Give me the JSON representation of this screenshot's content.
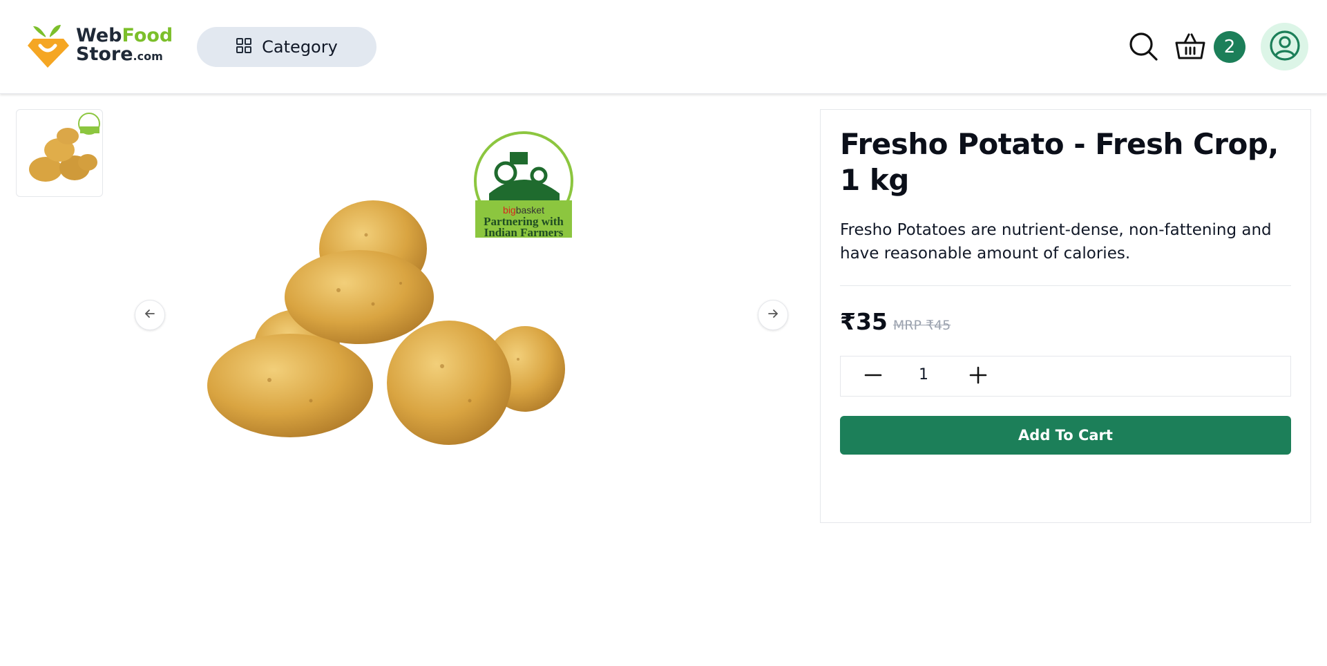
{
  "header": {
    "logo": {
      "web": "Web",
      "food": "Food",
      "store": "Store",
      "com": ".com"
    },
    "category_label": "Category",
    "cart_count": "2",
    "icons": {
      "category": "grid-icon",
      "search": "search-icon",
      "cart": "basket-icon",
      "account": "user-circle-icon"
    }
  },
  "product": {
    "title": "Fresho Potato - Fresh Crop, 1 kg",
    "description": "Fresho Potatoes are nutrient-dense, non-fattening and have reasonable amount of calories.",
    "price": "₹35",
    "mrp": "MRP ₹45",
    "quantity": "1",
    "add_to_cart_label": "Add To Cart"
  },
  "badge": {
    "brand_big": "big",
    "brand_basket": "basket",
    "line1": "Partnering with",
    "line2": "Indian Farmers"
  },
  "colors": {
    "accent": "#1c7f59",
    "logo_orange": "#f5a623",
    "logo_green": "#7cbf2b",
    "category_bg": "#e2e8f0",
    "avatar_bg": "#dcf5e7"
  }
}
